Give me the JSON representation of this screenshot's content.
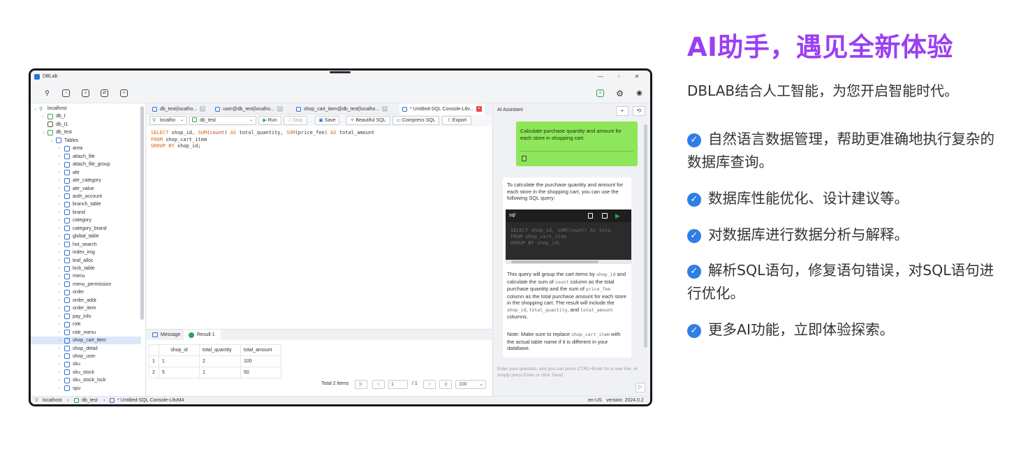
{
  "app": {
    "title": "DBLab",
    "tabs": [
      {
        "label": "db_test(localho...",
        "active": false
      },
      {
        "label": "user@db_test(localho...",
        "active": false
      },
      {
        "label": "shop_cart_item@db_test(localho...",
        "active": false
      },
      {
        "label": "* Untitled-SQL Console-L8v...",
        "active": true
      }
    ],
    "tree": {
      "connection": "localhost",
      "databases": [
        "db_t",
        "db_t1",
        "db_test"
      ],
      "tables_label": "Tables",
      "tables": [
        "area",
        "attach_file",
        "attach_file_group",
        "attr",
        "attr_category",
        "attr_value",
        "auth_account",
        "branch_table",
        "brand",
        "category",
        "category_brand",
        "global_table",
        "hot_search",
        "index_img",
        "leaf_alloc",
        "lock_table",
        "menu",
        "menu_permission",
        "order",
        "order_addr",
        "order_item",
        "pay_info",
        "role",
        "role_menu",
        "shop_cart_item",
        "shop_detail",
        "shop_user",
        "sku",
        "sku_stock",
        "sku_stock_lock",
        "spu"
      ],
      "selected": "shop_cart_item"
    },
    "editor_toolbar": {
      "connection": "localho",
      "database": "db_test",
      "run": "Run",
      "stop": "Stop",
      "save": "Save",
      "beautify": "Beautiful SQL",
      "compress": "Compress SQL",
      "export": "Export"
    },
    "sql": {
      "l1_kw1": "SELECT",
      "l1_a": " shop_id, ",
      "l1_fn1": "SUM",
      "l1_b": "(",
      "l1_count": "count",
      "l1_c": ") ",
      "l1_kw2": "AS",
      "l1_d": " total_quantity, ",
      "l1_fn2": "SUM",
      "l1_e": "(price_fee) ",
      "l1_kw3": "AS",
      "l1_f": " total_amount",
      "l2_kw": "FROM",
      "l2_rest": " shop_cart_item",
      "l3_kw": "GROUP BY",
      "l3_rest": " shop_id;"
    },
    "result": {
      "tabs": [
        "Message",
        "Result 1"
      ],
      "columns": [
        "shop_id",
        "total_quantity",
        "total_amount"
      ],
      "rows": [
        {
          "n": "1",
          "shop_id": "1",
          "total_quantity": "2",
          "total_amount": "100"
        },
        {
          "n": "2",
          "shop_id": "5",
          "total_quantity": "1",
          "total_amount": "50"
        }
      ],
      "total": "Total 2 items",
      "page": "1",
      "page_total": "/ 1",
      "page_size": "100"
    },
    "ai": {
      "title": "AI Assistant",
      "user_message": "Calculate purchase quantity and amount for each store in shopping cart.",
      "reply_intro": "To calculate the purchase quantity and amount for each store in the shopping cart, you can use the following SQL query:",
      "code_lang": "sql",
      "code": "SELECT shop_id, SUM(count) AS tota\nFROM shop_cart_item\nGROUP BY shop_id;",
      "reply_p1": "This query will group the cart items by",
      "reply_p1_code": "shop_id",
      "reply_p2": " and calculate the sum of ",
      "reply_p2_code": "count",
      "reply_p3": " column as the total purchase quantity and the sum of ",
      "reply_p3_code": "price_fee",
      "reply_p4": " column as the total purchase amount for each store in the shopping cart. The result will include the ",
      "reply_p4_code1": "shop_id",
      "reply_p4_sep1": ", ",
      "reply_p4_code2": "total_quantity",
      "reply_p4_sep2": ", and ",
      "reply_p4_code3": "total_amount",
      "reply_p4_end": " columns.",
      "note_1": "Note: Make sure to replace ",
      "note_code": "shop_cart_item",
      "note_2": " with the actual table name if it is different in your database.",
      "input_placeholder": "Enter your question, and you can press CTRL+Enter for a new line, or simply press Enter or click 'Send'."
    },
    "status": {
      "connection": "localhost",
      "database": "db_test",
      "console": "* Untitled-SQL Console-L8vM4",
      "locale": "en-US",
      "version": "version: 2024.0.2"
    }
  },
  "marketing": {
    "headline": "AI助手，遇见全新体验",
    "subtitle": "DBLAB结合人工智能，为您开启智能时代。",
    "features": [
      "自然语言数据管理，帮助更准确地执行复杂的数据库查询。",
      "数据库性能优化、设计建议等。",
      "对数据库进行数据分析与解释。",
      "解析SQL语句，修复语句错误，对SQL语句进行优化。",
      "更多AI功能，立即体验探索。"
    ],
    "headline_color": "#9b3ff2",
    "check_color": "#2f7ee6"
  }
}
